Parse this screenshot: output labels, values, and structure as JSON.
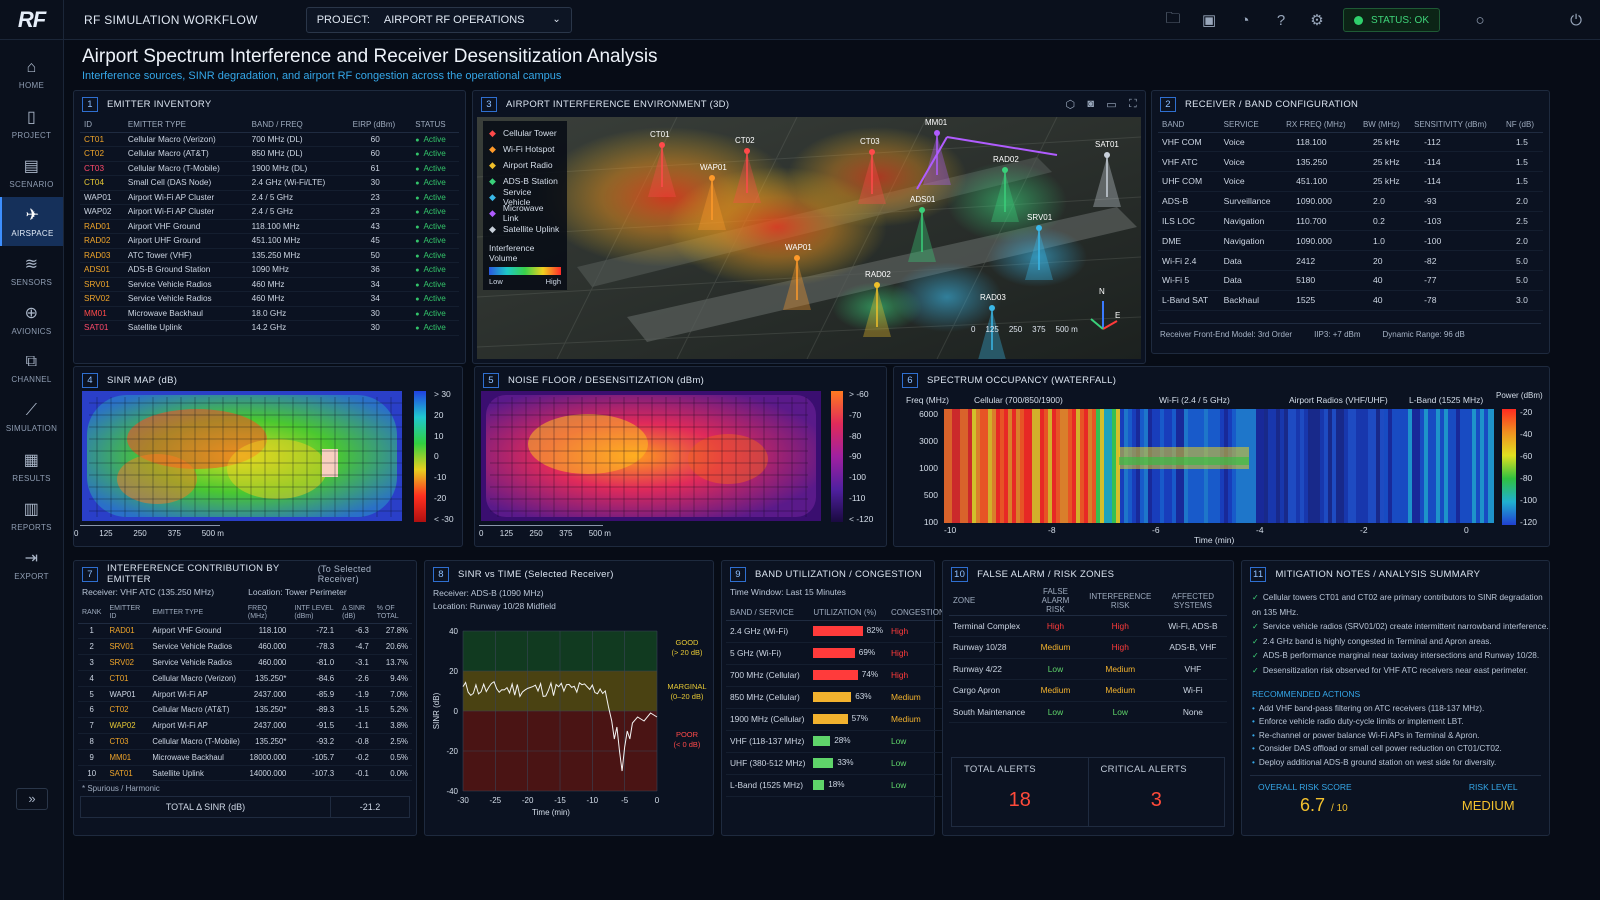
{
  "app": {
    "logo": "RF",
    "workflow": "RF SIMULATION WORKFLOW",
    "project_label": "PROJECT:",
    "project_value": "AIRPORT RF OPERATIONS",
    "status": "STATUS: OK"
  },
  "nav": [
    {
      "label": "HOME",
      "icon": "⌂"
    },
    {
      "label": "PROJECT",
      "icon": "▯"
    },
    {
      "label": "SCENARIO",
      "icon": "▤"
    },
    {
      "label": "AIRSPACE",
      "icon": "✈"
    },
    {
      "label": "SENSORS",
      "icon": "≋"
    },
    {
      "label": "AVIONICS",
      "icon": "⊕"
    },
    {
      "label": "CHANNEL",
      "icon": "⧉"
    },
    {
      "label": "SIMULATION",
      "icon": "⟋"
    },
    {
      "label": "RESULTS",
      "icon": "▦"
    },
    {
      "label": "REPORTS",
      "icon": "▥"
    },
    {
      "label": "EXPORT",
      "icon": "⇥"
    }
  ],
  "page": {
    "title": "Airport Spectrum Interference and Receiver Desensitization Analysis",
    "subtitle": "Interference sources, SINR degradation, and airport RF congestion across the operational campus"
  },
  "emitters": {
    "num": "1",
    "title": "EMITTER INVENTORY",
    "headers": [
      "ID",
      "EMITTER TYPE",
      "BAND / FREQ",
      "EIRP (dBm)",
      "STATUS"
    ],
    "rows": [
      [
        "CT01",
        "Cellular Macro (Verizon)",
        "700 MHz (DL)",
        "60",
        "Active",
        "#f0a52a"
      ],
      [
        "CT02",
        "Cellular Macro (AT&T)",
        "850 MHz (DL)",
        "60",
        "Active",
        "#f0a52a"
      ],
      [
        "CT03",
        "Cellular Macro (T-Mobile)",
        "1900 MHz (DL)",
        "61",
        "Active",
        "#ff4a6a"
      ],
      [
        "CT04",
        "Small Cell (DAS Node)",
        "2.4 GHz (Wi-Fi/LTE)",
        "30",
        "Active",
        "#e6c835"
      ],
      [
        "WAP01",
        "Airport Wi-Fi AP Cluster",
        "2.4 / 5 GHz",
        "23",
        "Active",
        "#cdd6e3"
      ],
      [
        "WAP02",
        "Airport Wi-Fi AP Cluster",
        "2.4 / 5 GHz",
        "23",
        "Active",
        "#cdd6e3"
      ],
      [
        "RAD01",
        "Airport VHF Ground",
        "118.100 MHz",
        "43",
        "Active",
        "#f0a52a"
      ],
      [
        "RAD02",
        "Airport UHF Ground",
        "451.100 MHz",
        "45",
        "Active",
        "#f0a52a"
      ],
      [
        "RAD03",
        "ATC Tower (VHF)",
        "135.250 MHz",
        "50",
        "Active",
        "#f0a52a"
      ],
      [
        "ADS01",
        "ADS-B Ground Station",
        "1090 MHz",
        "36",
        "Active",
        "#f0a52a"
      ],
      [
        "SRV01",
        "Service Vehicle Radios",
        "460 MHz",
        "34",
        "Active",
        "#f0a52a"
      ],
      [
        "SRV02",
        "Service Vehicle Radios",
        "460 MHz",
        "34",
        "Active",
        "#f0a52a"
      ],
      [
        "MM01",
        "Microwave Backhaul",
        "18.0 GHz",
        "30",
        "Active",
        "#ff4a4a"
      ],
      [
        "SAT01",
        "Satellite Uplink",
        "14.2 GHz",
        "30",
        "Active",
        "#ff4a6a"
      ]
    ]
  },
  "env3d": {
    "num": "3",
    "title": "AIRPORT INTERFERENCE ENVIRONMENT (3D)",
    "legend": [
      {
        "label": "Cellular Tower",
        "color": "#ff4a4a",
        "icon": "tower-icon"
      },
      {
        "label": "Wi-Fi Hotspot",
        "color": "#ff9a2a",
        "icon": "wifi-icon"
      },
      {
        "label": "Airport Radio",
        "color": "#f0c02a",
        "icon": "radio-icon"
      },
      {
        "label": "ADS-B Station",
        "color": "#3ad07a",
        "icon": "adsb-icon"
      },
      {
        "label": "Service Vehicle",
        "color": "#3ab8e8",
        "icon": "vehicle-icon"
      },
      {
        "label": "Microwave Link",
        "color": "#b05cff",
        "icon": "microwave-icon"
      },
      {
        "label": "Satellite Uplink",
        "color": "#c8d0da",
        "icon": "satellite-icon"
      }
    ],
    "vol_title": "Interference Volume",
    "vol_low": "Low",
    "vol_high": "High",
    "labels": [
      "CT01",
      "CT02",
      "CT03",
      "MM01",
      "RAD02",
      "SAT01",
      "WAP01",
      "ADS01",
      "SRV01",
      "WAP01",
      "RAD02",
      "RAD03"
    ],
    "scale": [
      "0",
      "125",
      "250",
      "375",
      "500 m"
    ],
    "compass": {
      "n": "N",
      "e": "E"
    }
  },
  "receivers": {
    "num": "2",
    "title": "RECEIVER / BAND CONFIGURATION",
    "headers": [
      "BAND",
      "SERVICE",
      "RX FREQ (MHz)",
      "BW (MHz)",
      "SENSITIVITY (dBm)",
      "NF (dB)"
    ],
    "rows": [
      [
        "VHF COM",
        "Voice",
        "118.100",
        "25 kHz",
        "-112",
        "1.5"
      ],
      [
        "VHF ATC",
        "Voice",
        "135.250",
        "25 kHz",
        "-114",
        "1.5"
      ],
      [
        "UHF COM",
        "Voice",
        "451.100",
        "25 kHz",
        "-114",
        "1.5"
      ],
      [
        "ADS-B",
        "Surveillance",
        "1090.000",
        "2.0",
        "-93",
        "2.0"
      ],
      [
        "ILS LOC",
        "Navigation",
        "110.700",
        "0.2",
        "-103",
        "2.5"
      ],
      [
        "DME",
        "Navigation",
        "1090.000",
        "1.0",
        "-100",
        "2.0"
      ],
      [
        "Wi-Fi 2.4",
        "Data",
        "2412",
        "20",
        "-82",
        "5.0"
      ],
      [
        "Wi-Fi 5",
        "Data",
        "5180",
        "40",
        "-77",
        "5.0"
      ],
      [
        "L-Band SAT",
        "Backhaul",
        "1525",
        "40",
        "-78",
        "3.0"
      ]
    ],
    "footer": [
      "Receiver Front-End Model: 3rd Order",
      "IIP3: +7 dBm",
      "Dynamic Range: 96 dB"
    ]
  },
  "sinr_map": {
    "num": "4",
    "title": "SINR MAP (dB)",
    "scale_labels": [
      "> 30",
      "20",
      "10",
      "0",
      "-10",
      "-20",
      "< -30"
    ],
    "axis": [
      "0",
      "125",
      "250",
      "375",
      "500 m"
    ]
  },
  "noise_map": {
    "num": "5",
    "title": "NOISE FLOOR / DESENSITIZATION (dBm)",
    "scale_labels": [
      "> -60",
      "-70",
      "-80",
      "-90",
      "-100",
      "-110",
      "< -120"
    ],
    "axis": [
      "0",
      "125",
      "250",
      "375",
      "500 m"
    ]
  },
  "waterfall": {
    "num": "6",
    "title": "SPECTRUM OCCUPANCY (WATERFALL)",
    "ylabel": "Freq (MHz)",
    "yticks": [
      "6000",
      "3000",
      "1000",
      "500",
      "100"
    ],
    "bands": [
      "Cellular (700/850/1900)",
      "Wi-Fi (2.4 / 5 GHz)",
      "Airport Radios (VHF/UHF)",
      "L-Band (1525 MHz)"
    ],
    "xticks": [
      "-10",
      "-8",
      "-6",
      "-4",
      "-2",
      "0"
    ],
    "xlabel": "Time (min)",
    "power_label": "Power (dBm)",
    "power_ticks": [
      "-20",
      "-40",
      "-60",
      "-80",
      "-100",
      "-120"
    ]
  },
  "contrib": {
    "num": "7",
    "title": "INTERFERENCE CONTRIBUTION BY EMITTER",
    "title_extra": "(To Selected Receiver)",
    "receiver": "Receiver: VHF ATC (135.250 MHz)",
    "location": "Location: Tower Perimeter",
    "headers": [
      "RANK",
      "EMITTER ID",
      "EMITTER TYPE",
      "FREQ (MHz)",
      "INTF LEVEL (dBm)",
      "Δ SINR (dB)",
      "% OF TOTAL"
    ],
    "rows": [
      [
        "1",
        "RAD01",
        "Airport VHF Ground",
        "118.100",
        "-72.1",
        "-6.3",
        "27.8%",
        "#f0a52a"
      ],
      [
        "2",
        "SRV01",
        "Service Vehicle Radios",
        "460.000",
        "-78.3",
        "-4.7",
        "20.6%",
        "#f0a52a"
      ],
      [
        "3",
        "SRV02",
        "Service Vehicle Radios",
        "460.000",
        "-81.0",
        "-3.1",
        "13.7%",
        "#f0a52a"
      ],
      [
        "4",
        "CT01",
        "Cellular Macro (Verizon)",
        "135.250*",
        "-84.6",
        "-2.6",
        "9.4%",
        "#f0a52a"
      ],
      [
        "5",
        "WAP01",
        "Airport Wi-Fi AP",
        "2437.000",
        "-85.9",
        "-1.9",
        "7.0%",
        "#cdd6e3"
      ],
      [
        "6",
        "CT02",
        "Cellular Macro (AT&T)",
        "135.250*",
        "-89.3",
        "-1.5",
        "5.2%",
        "#f0a52a"
      ],
      [
        "7",
        "WAP02",
        "Airport Wi-Fi AP",
        "2437.000",
        "-91.5",
        "-1.1",
        "3.8%",
        "#e6c835"
      ],
      [
        "8",
        "CT03",
        "Cellular Macro (T-Mobile)",
        "135.250*",
        "-93.2",
        "-0.8",
        "2.5%",
        "#f0a52a"
      ],
      [
        "9",
        "MM01",
        "Microwave Backhaul",
        "18000.000",
        "-105.7",
        "-0.2",
        "0.5%",
        "#f0a52a"
      ],
      [
        "10",
        "SAT01",
        "Satellite Uplink",
        "14000.000",
        "-107.3",
        "-0.1",
        "0.0%",
        "#f0a52a"
      ]
    ],
    "footnote": "* Spurious / Harmonic",
    "total_label": "TOTAL Δ SINR (dB)",
    "total_value": "-21.2"
  },
  "sinr_time": {
    "num": "8",
    "title": "SINR vs TIME (Selected Receiver)",
    "receiver": "Receiver: ADS-B (1090 MHz)",
    "location": "Location: Runway 10/28 Midfield",
    "ylabel": "SINR (dB)",
    "xlabel": "Time (min)",
    "yticks": [
      "40",
      "20",
      "0",
      "-20",
      "-40"
    ],
    "xticks": [
      "-30",
      "-25",
      "-20",
      "-15",
      "-10",
      "-5",
      "0"
    ],
    "zone_good": "GOOD",
    "zone_good2": "(> 20 dB)",
    "zone_marg": "MARGINAL",
    "zone_marg2": "(0–20 dB)",
    "zone_poor": "POOR",
    "zone_poor2": "(< 0 dB)"
  },
  "util": {
    "num": "9",
    "title": "BAND UTILIZATION / CONGESTION",
    "window": "Time Window: Last 15 Minutes",
    "headers": [
      "BAND / SERVICE",
      "UTILIZATION (%)",
      "CONGESTION"
    ],
    "rows": [
      {
        "band": "2.4 GHz (Wi-Fi)",
        "pct": 82,
        "label": "82%",
        "cong": "High"
      },
      {
        "band": "5 GHz (Wi-Fi)",
        "pct": 69,
        "label": "69%",
        "cong": "High"
      },
      {
        "band": "700 MHz (Cellular)",
        "pct": 74,
        "label": "74%",
        "cong": "High"
      },
      {
        "band": "850 MHz (Cellular)",
        "pct": 63,
        "label": "63%",
        "cong": "Medium"
      },
      {
        "band": "1900 MHz (Cellular)",
        "pct": 57,
        "label": "57%",
        "cong": "Medium"
      },
      {
        "band": "VHF (118-137 MHz)",
        "pct": 28,
        "label": "28%",
        "cong": "Low"
      },
      {
        "band": "UHF (380-512 MHz)",
        "pct": 33,
        "label": "33%",
        "cong": "Low"
      },
      {
        "band": "L-Band (1525 MHz)",
        "pct": 18,
        "label": "18%",
        "cong": "Low"
      }
    ]
  },
  "risk": {
    "num": "10",
    "title": "FALSE ALARM / RISK ZONES",
    "headers": [
      "ZONE",
      "FALSE ALARM RISK",
      "INTERFERENCE RISK",
      "AFFECTED SYSTEMS"
    ],
    "rows": [
      [
        "Terminal Complex",
        "High",
        "High",
        "Wi-Fi, ADS-B"
      ],
      [
        "Runway 10/28",
        "Medium",
        "High",
        "ADS-B, VHF"
      ],
      [
        "Runway 4/22",
        "Low",
        "Medium",
        "VHF"
      ],
      [
        "Cargo Apron",
        "Medium",
        "Medium",
        "Wi-Fi"
      ],
      [
        "South Maintenance",
        "Low",
        "Low",
        "None"
      ]
    ],
    "total_label": "TOTAL ALERTS",
    "total": "18",
    "crit_label": "CRITICAL ALERTS",
    "crit": "3"
  },
  "notes": {
    "num": "11",
    "title": "MITIGATION NOTES / ANALYSIS SUMMARY",
    "items": [
      "Cellular towers CT01 and CT02 are primary contributors to SINR degradation on 135 MHz.",
      "Service vehicle radios (SRV01/02) create intermittent narrowband interference.",
      "2.4 GHz band is highly congested in Terminal and Apron areas.",
      "ADS-B performance marginal near taxiway intersections and Runway 10/28.",
      "Desensitization risk observed for VHF ATC receivers near east perimeter."
    ],
    "rec_title": "RECOMMENDED ACTIONS",
    "recs": [
      "Add VHF band-pass filtering on ATC receivers (118-137 MHz).",
      "Enforce vehicle radio duty-cycle limits or implement LBT.",
      "Re-channel or power balance Wi-Fi APs in Terminal & Apron.",
      "Consider DAS offload or small cell power reduction on CT01/CT02.",
      "Deploy additional ADS-B ground station on west side for diversity."
    ],
    "score_label": "OVERALL RISK SCORE",
    "score": "6.7",
    "score_of": "/ 10",
    "level_label": "RISK LEVEL",
    "level": "MEDIUM"
  }
}
